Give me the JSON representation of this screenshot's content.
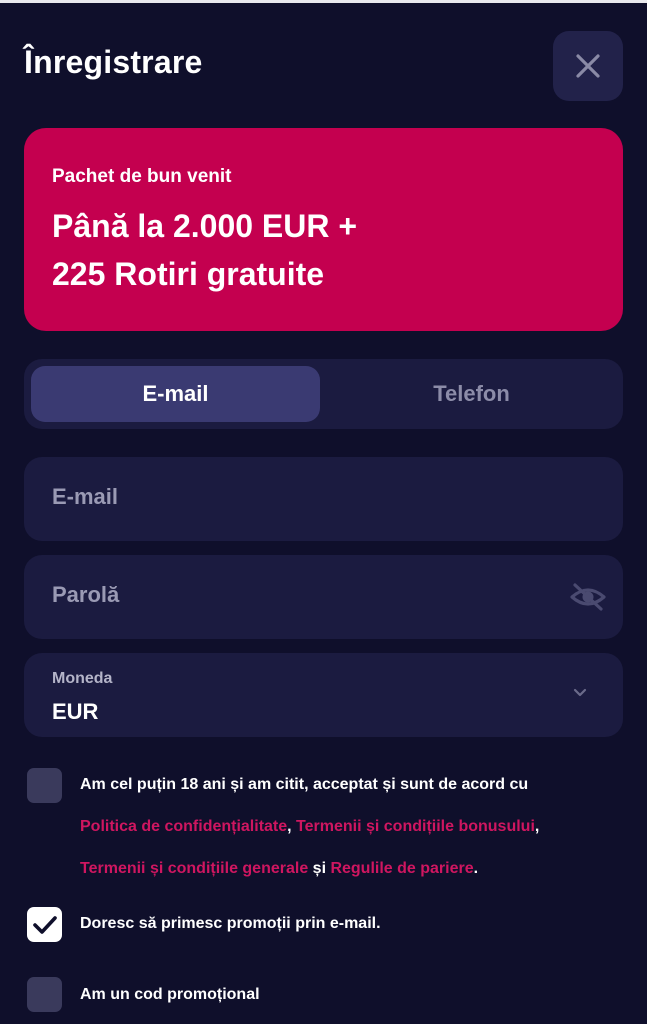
{
  "header": {
    "title": "Înregistrare"
  },
  "banner": {
    "subtitle": "Pachet de bun venit",
    "line1": "Până la 2.000 EUR +",
    "line2": "225 Rotiri gratuite"
  },
  "tabs": [
    {
      "label": "E-mail",
      "active": true
    },
    {
      "label": "Telefon",
      "active": false
    }
  ],
  "form": {
    "email_placeholder": "E-mail",
    "password_placeholder": "Parolă",
    "currency_label": "Moneda",
    "currency_value": "EUR"
  },
  "consent": {
    "line1": "Am cel puțin 18 ani și am citit, acceptat și sunt de acord cu",
    "link_privacy": "Politica de confidențialitate",
    "sep1": ", ",
    "link_bonus_terms": "Termenii și condițiile bonusului",
    "sep2": ",",
    "link_general_terms": "Termenii și condițiile generale",
    "and": " și ",
    "link_betting_rules": "Regulile de pariere",
    "end": ".",
    "checked": false
  },
  "promo_email": {
    "label": "Doresc să primesc promoții prin e-mail.",
    "checked": true
  },
  "promo_code": {
    "label": "Am un cod promoțional",
    "checked": false
  },
  "colors": {
    "background": "#0f0f2b",
    "panel": "#1b1b40",
    "banner": "#c4004f",
    "link": "#cf1660",
    "active_tab": "#3a3a72"
  }
}
